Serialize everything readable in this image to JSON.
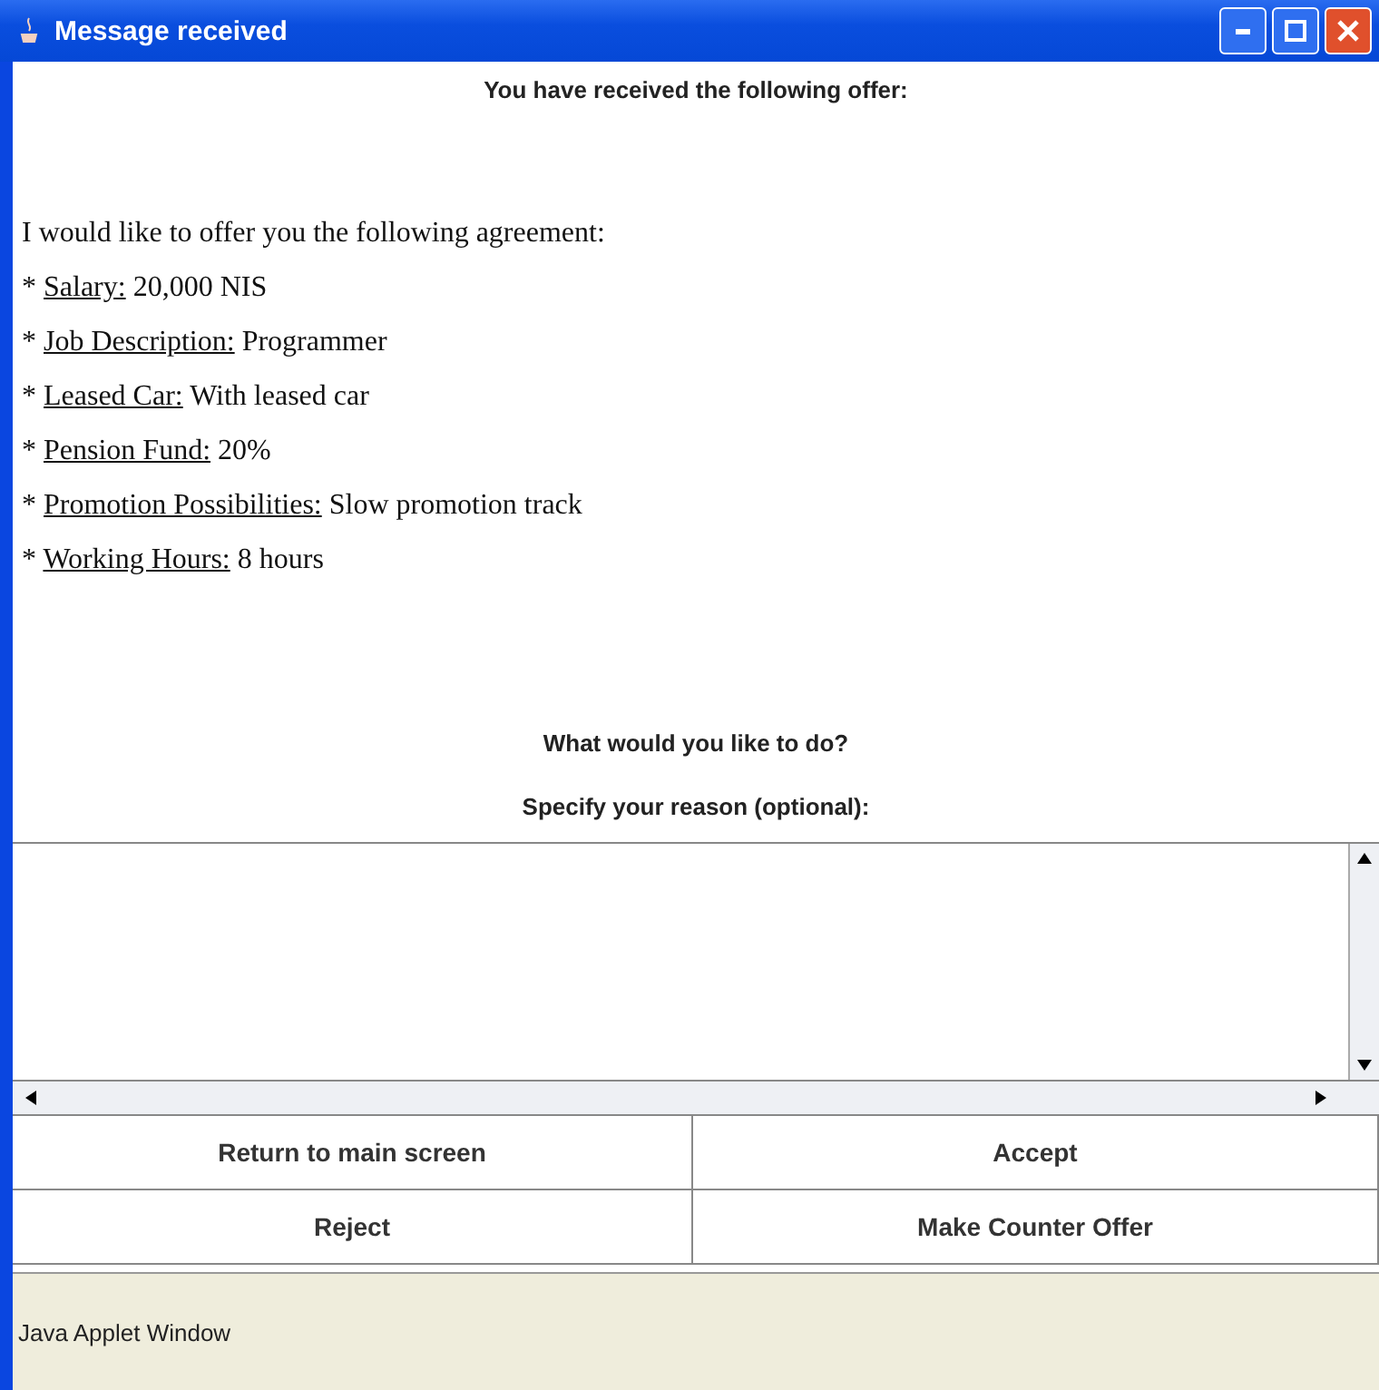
{
  "window": {
    "title": "Message received"
  },
  "heading": "You have received the following offer:",
  "intro": "I would like to offer you the following agreement:",
  "terms": [
    {
      "bullet": "*",
      "label": "Salary:",
      "value": "20,000 NIS"
    },
    {
      "bullet": "*",
      "label": "Job Description:",
      "value": "Programmer"
    },
    {
      "bullet": "*",
      "label": "Leased Car:",
      "value": "With leased car"
    },
    {
      "bullet": "*",
      "label": "Pension Fund:",
      "value": "20%"
    },
    {
      "bullet": "*",
      "label": "Promotion Possibilities:",
      "value": "Slow promotion track"
    },
    {
      "bullet": "*",
      "label": "Working Hours:",
      "value": "8 hours"
    }
  ],
  "question": "What would you like to do?",
  "reason_label": "Specify your reason (optional):",
  "buttons": [
    "Return to main screen",
    "Accept",
    "Reject",
    "Make Counter Offer"
  ],
  "status_bar": "Java Applet Window"
}
